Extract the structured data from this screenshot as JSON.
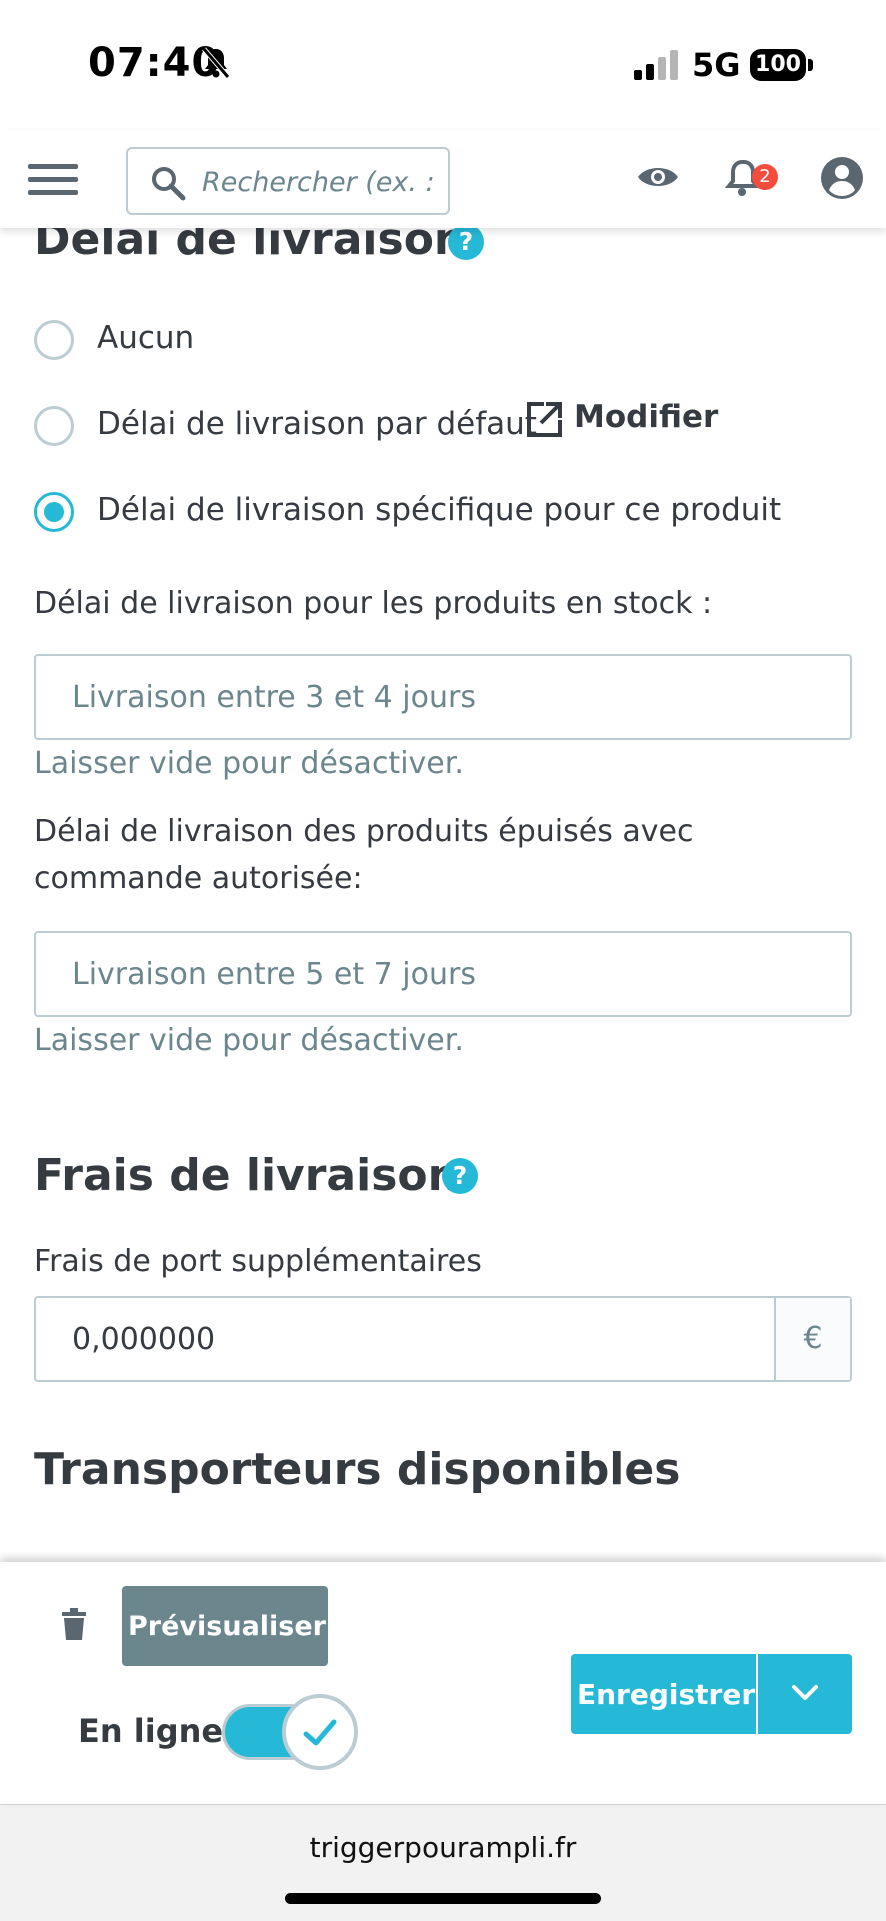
{
  "status_bar": {
    "time": "07:40",
    "network": "5G",
    "battery": "100"
  },
  "header": {
    "search_placeholder": "Rechercher (ex. : r",
    "notification_count": "2"
  },
  "delivery_time": {
    "title": "Délai de livraison",
    "help": "?",
    "options": [
      {
        "label": "Aucun",
        "checked": false
      },
      {
        "label": "Délai de livraison par défaut",
        "checked": false
      },
      {
        "label": "Délai de livraison spécifique pour ce produit",
        "checked": true
      }
    ],
    "modify_label": "Modifier",
    "in_stock": {
      "label": "Délai de livraison pour les produits en stock :",
      "placeholder": "Livraison entre 3 et 4 jours",
      "hint": "Laisser vide pour désactiver."
    },
    "out_of_stock": {
      "label": "Délai de livraison des produits épuisés avec commande autorisée:",
      "placeholder": "Livraison entre 5 et 7 jours",
      "hint": "Laisser vide pour désactiver."
    }
  },
  "shipping_fees": {
    "title": "Frais de livraison",
    "help": "?",
    "label": "Frais de port supplémentaires",
    "value": "0,000000",
    "currency": "€"
  },
  "carriers": {
    "title": "Transporteurs disponibles"
  },
  "toolbar": {
    "preview_label": "Prévisualiser",
    "online_label": "En ligne",
    "online_enabled": true,
    "save_label": "Enregistrer"
  },
  "browser": {
    "url": "triggerpourampli.fr"
  },
  "colors": {
    "accent": "#25b9d7",
    "secondary": "#6c868e",
    "text": "#363a41",
    "border": "#bbcdd2",
    "badge": "#f54c3e"
  }
}
